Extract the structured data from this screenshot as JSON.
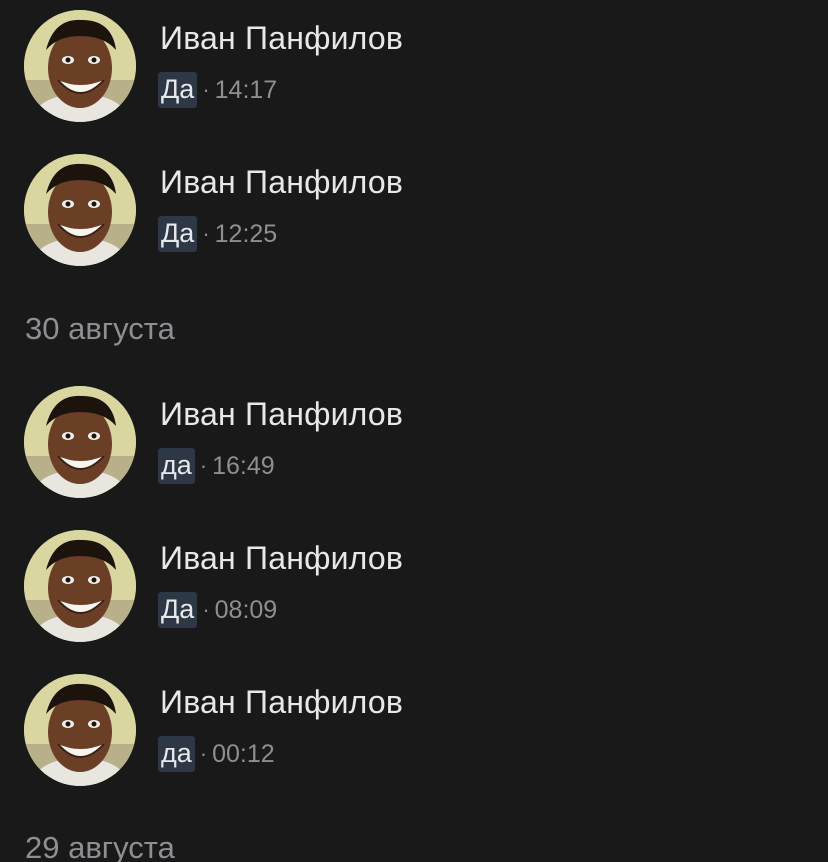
{
  "colors": {
    "background": "#19191a",
    "name_text": "#e8e8ea",
    "highlight_bg": "#2d3746",
    "secondary_text": "#8e8e93"
  },
  "groups": [
    {
      "date": "",
      "entries": [
        {
          "name": "Иван Панфилов",
          "message": "Да",
          "separator": "·",
          "time": "14:17",
          "avatar_icon": "user-avatar-icon"
        },
        {
          "name": "Иван Панфилов",
          "message": "Да",
          "separator": "·",
          "time": "12:25",
          "avatar_icon": "user-avatar-icon"
        }
      ]
    },
    {
      "date": "30 августа",
      "entries": [
        {
          "name": "Иван Панфилов",
          "message": "да",
          "separator": "·",
          "time": "16:49",
          "avatar_icon": "user-avatar-icon"
        },
        {
          "name": "Иван Панфилов",
          "message": "Да",
          "separator": "·",
          "time": "08:09",
          "avatar_icon": "user-avatar-icon"
        },
        {
          "name": "Иван Панфилов",
          "message": "да",
          "separator": "·",
          "time": "00:12",
          "avatar_icon": "user-avatar-icon"
        }
      ]
    },
    {
      "date": "29 августа",
      "entries": []
    }
  ]
}
